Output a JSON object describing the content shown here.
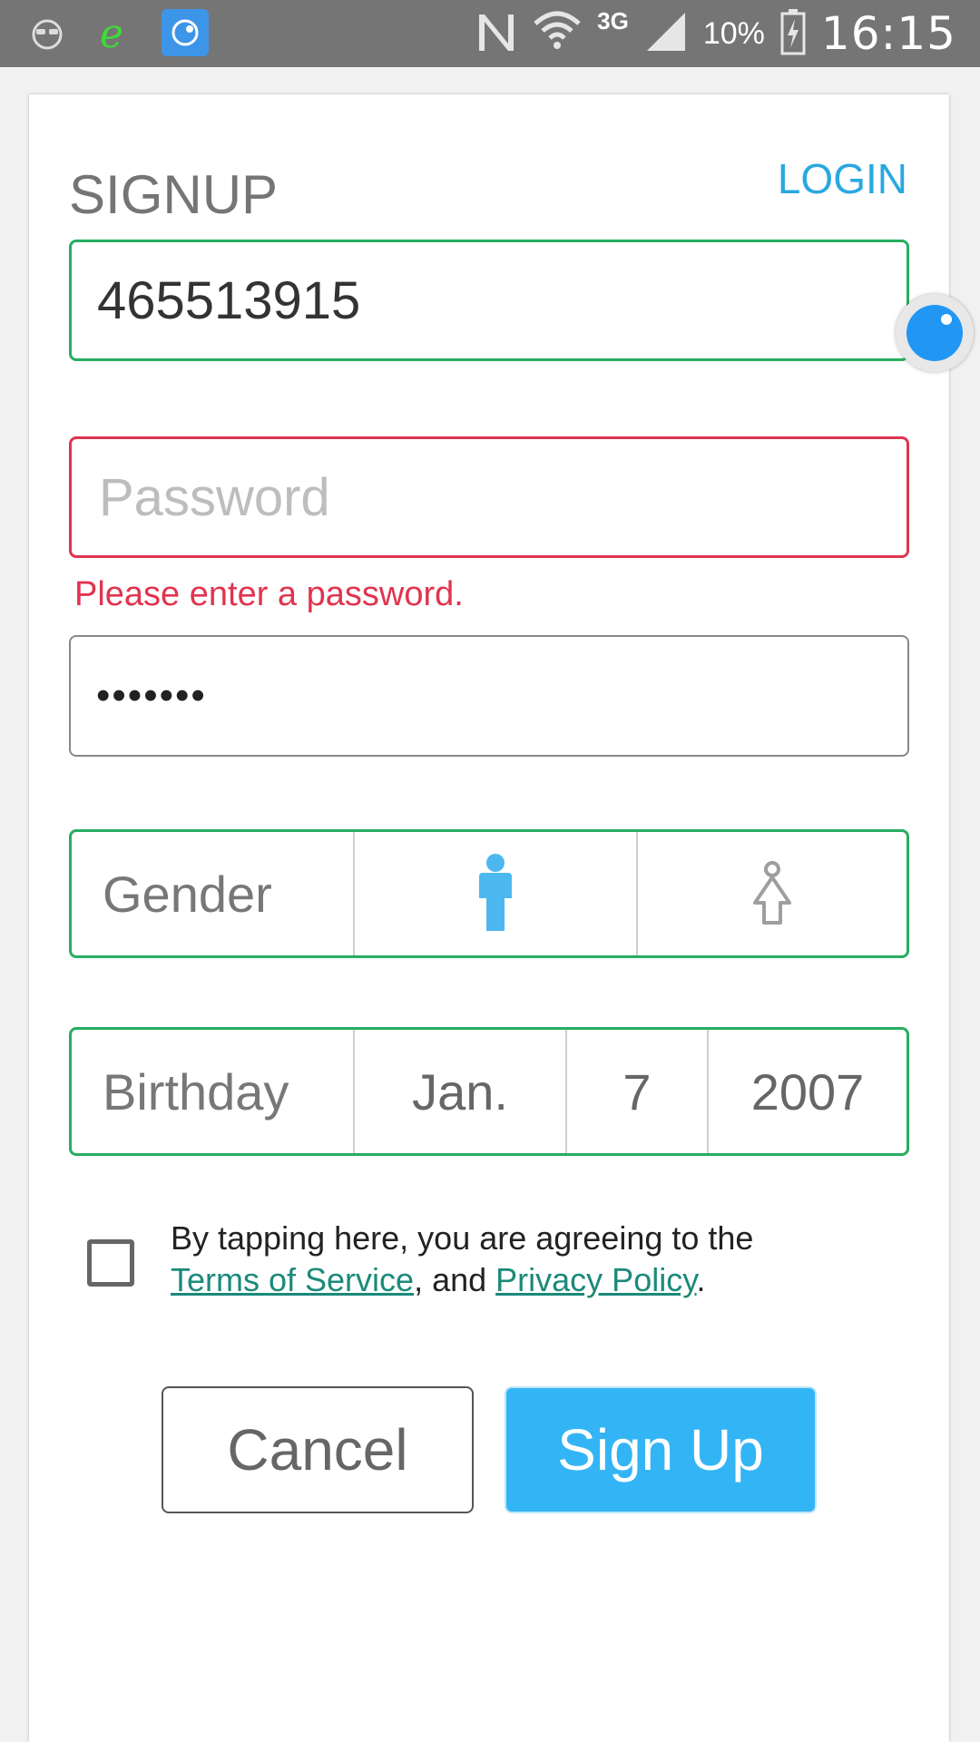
{
  "status_bar": {
    "time": "16:15",
    "battery_text": "10%",
    "network": "3G",
    "icons": [
      "face-notification-icon",
      "browser-e-icon",
      "app-clock-icon",
      "nfc-n-icon",
      "wifi-icon",
      "signal-icon",
      "battery-charging-icon"
    ]
  },
  "header": {
    "title": "SIGNUP",
    "login_link": "LOGIN"
  },
  "form": {
    "phone_value": "465513915",
    "password_placeholder": "Password",
    "password_error": "Please enter a password.",
    "confirm_masked": "•••••••",
    "gender_label": "Gender",
    "birthday_label": "Birthday",
    "birth_month": "Jan.",
    "birth_day": "7",
    "birth_year": "2007",
    "selected_gender": "male"
  },
  "terms": {
    "prefix": "By tapping here, you are agreeing to the ",
    "terms_link": "Terms of Service",
    "middle": ", and ",
    "privacy_link": "Privacy Policy",
    "suffix": "."
  },
  "buttons": {
    "cancel": "Cancel",
    "signup": "Sign Up"
  },
  "colors": {
    "accent": "#33b5f5",
    "valid": "#27ae60",
    "error": "#e0344f",
    "link": "#1b8a7a"
  }
}
